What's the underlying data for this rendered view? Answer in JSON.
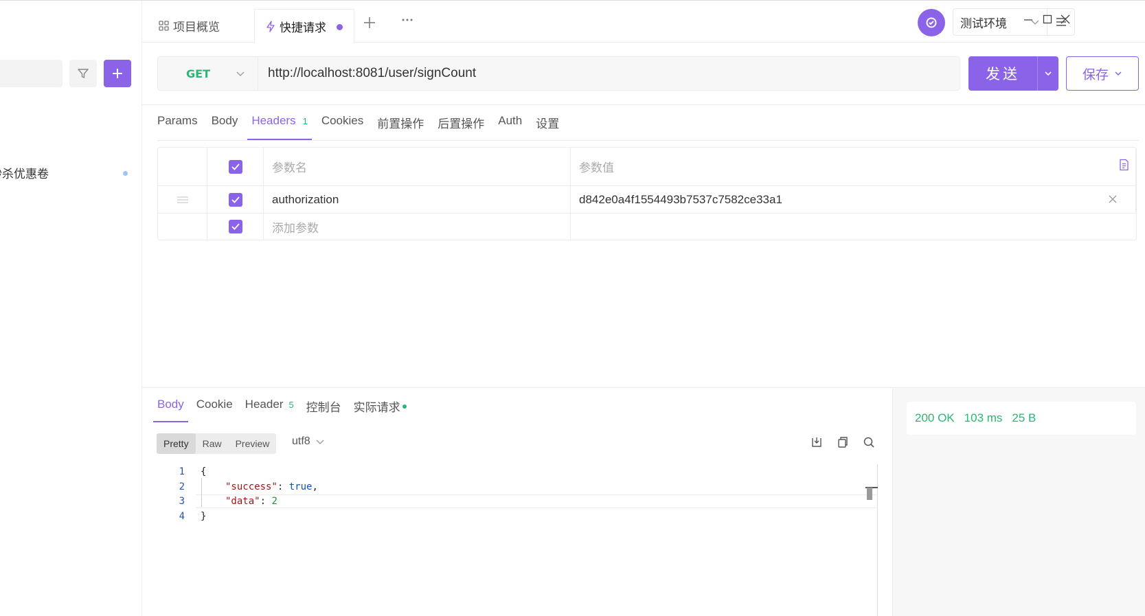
{
  "sidebar": {
    "item_label": "秒杀优惠卷"
  },
  "tabs": {
    "overview": "项目概览",
    "quick_request": "快捷请求"
  },
  "env": {
    "selected": "测试环境"
  },
  "request": {
    "method": "GET",
    "url": "http://localhost:8081/user/signCount",
    "send_label": "发送",
    "save_label": "保存"
  },
  "req_tabs": [
    {
      "label": "Params"
    },
    {
      "label": "Body"
    },
    {
      "label": "Headers",
      "count": "1",
      "active": true
    },
    {
      "label": "Cookies"
    },
    {
      "label": "前置操作"
    },
    {
      "label": "后置操作"
    },
    {
      "label": "Auth"
    },
    {
      "label": "设置"
    }
  ],
  "headers_table": {
    "col_name": "参数名",
    "col_value": "参数值",
    "rows": [
      {
        "name": "authorization",
        "value": "d842e0a4f1554493b7537c7582ce33a1"
      }
    ],
    "add_placeholder": "添加参数"
  },
  "resp_tabs": [
    {
      "label": "Body",
      "active": true
    },
    {
      "label": "Cookie"
    },
    {
      "label": "Header",
      "count": "5"
    },
    {
      "label": "控制台"
    },
    {
      "label": "实际请求"
    }
  ],
  "format_tabs": [
    "Pretty",
    "Raw",
    "Preview"
  ],
  "encoding": "utf8",
  "response_code": {
    "line_numbers": [
      "1",
      "2",
      "3",
      "4"
    ],
    "line1": "{",
    "key1": "\"success\"",
    "val1": "true",
    "key2": "\"data\"",
    "val2": "2",
    "line4": "}"
  },
  "status": {
    "code": "200 OK",
    "time": "103 ms",
    "size": "25 B"
  },
  "colors": {
    "accent": "#8b63e8",
    "success": "#2bb673"
  }
}
